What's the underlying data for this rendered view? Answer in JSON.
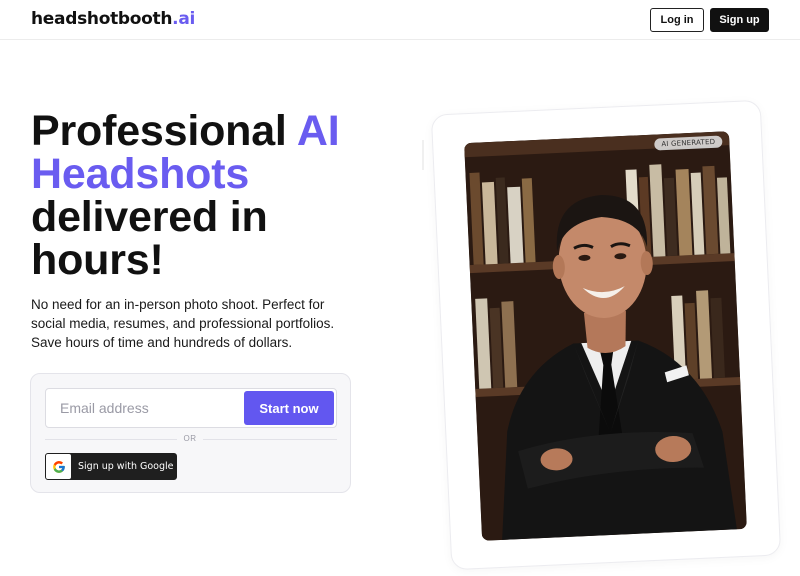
{
  "header": {
    "logo_main": "headshotbooth",
    "logo_accent": ".ai",
    "login_label": "Log in",
    "signup_label": "Sign up"
  },
  "hero": {
    "title_line1_plain": "Professional ",
    "title_line1_accent": "AI",
    "title_line2_accent": "Headshots",
    "title_line3": "delivered in",
    "title_line4": "hours!",
    "description": "No need for an in-person photo shoot. Perfect for social media, resumes, and professional portfolios. Save hours of time and hundreds of dollars."
  },
  "signup_form": {
    "email_placeholder": "Email address",
    "email_value": "",
    "start_label": "Start now",
    "divider_label": "OR",
    "google_label": "Sign up with Google"
  },
  "photo": {
    "badge_label": "AI GENERATED"
  },
  "colors": {
    "accent": "#6a5cf0",
    "button_start": "#6257f0",
    "dark_button": "#111111"
  },
  "icons": {
    "google": "google-g-icon"
  }
}
